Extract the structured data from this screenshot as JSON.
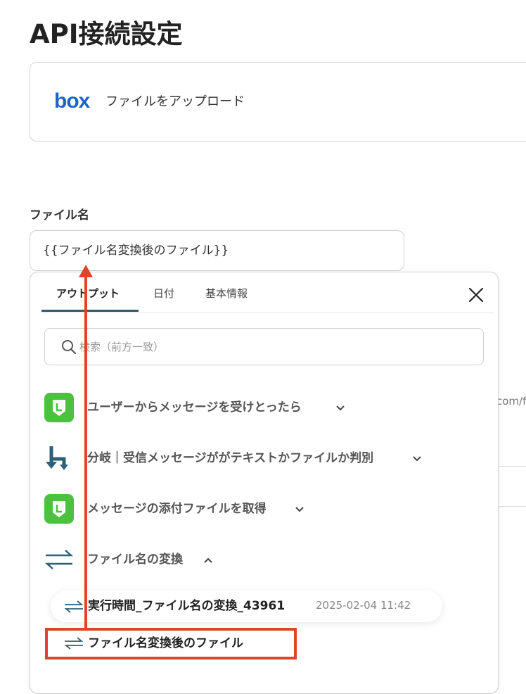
{
  "page": {
    "title": "API接続設定"
  },
  "app_card": {
    "logo_text": "box",
    "action": "ファイルをアップロード"
  },
  "field": {
    "label": "ファイル名",
    "value": "{{ファイル名変換後のファイル}}"
  },
  "background": {
    "snippet": "com/f"
  },
  "panel": {
    "tabs": [
      {
        "label": "アウトプット",
        "active": true
      },
      {
        "label": "日付",
        "active": false
      },
      {
        "label": "基本情報",
        "active": false
      }
    ],
    "search": {
      "placeholder": "検索（前方一致）"
    },
    "sections": [
      {
        "label": "ユーザーからメッセージを受けとったら",
        "icon": "line-app-icon",
        "expanded": false
      },
      {
        "label": "分岐｜受信メッセージががテキストかファイルか判別",
        "icon": "branch-icon",
        "expanded": false
      },
      {
        "label": "メッセージの添付ファイルを取得",
        "icon": "line-app-icon",
        "expanded": false
      },
      {
        "label": "ファイル名の変換",
        "icon": "convert-icon",
        "expanded": true
      }
    ],
    "items": [
      {
        "label": "実行時間_ファイル名の変換_43961",
        "timestamp": "2025-02-04 11:42"
      },
      {
        "label": "ファイル名変換後のファイル",
        "timestamp": ""
      }
    ]
  },
  "colors": {
    "line_green": "#4cc13f",
    "branch_teal": "#2c6177",
    "accent_tab": "#2f5b6e",
    "highlight_red": "#e0422a"
  }
}
